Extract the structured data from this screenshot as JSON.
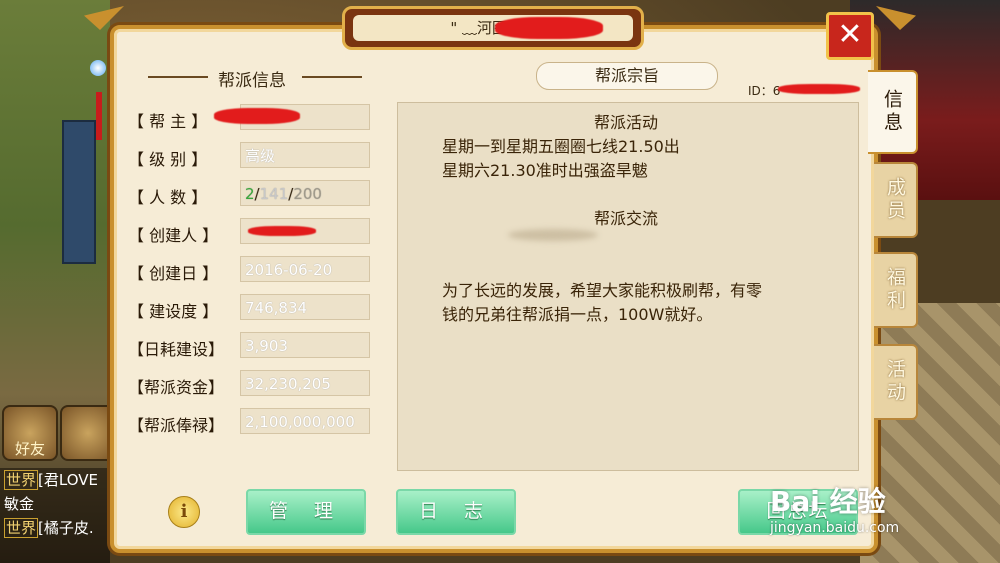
{
  "window": {
    "title": "\" ﹏河图......",
    "close_icon_glyph": "✕"
  },
  "left": {
    "section_title": "帮派信息",
    "rows": [
      {
        "label": "【  帮  主  】",
        "value": ""
      },
      {
        "label": "【  级  别  】",
        "value": "高级"
      },
      {
        "label": "【  人  数  】",
        "value": ""
      },
      {
        "label": "【  创建人  】",
        "value": ""
      },
      {
        "label": "【  创建日  】",
        "value": "2016-06-20"
      },
      {
        "label": "【  建设度  】",
        "value": "746,834"
      },
      {
        "label": "【日耗建设】",
        "value": "3,903"
      },
      {
        "label": "【帮派资金】",
        "value": "32,230,205"
      },
      {
        "label": "【帮派俸禄】",
        "value": "2,100,000,000"
      }
    ],
    "member_count": {
      "online": "2",
      "members": "141",
      "max": "200",
      "sep": "/"
    }
  },
  "right": {
    "purpose_button": "帮派宗旨",
    "id_label": "ID：6",
    "content": {
      "heading1": "帮派活动",
      "line1": "星期一到星期五圈圈七线21.50出",
      "line2": "星期六21.30准时出强盗旱魃",
      "heading2": "帮派交流",
      "para_line1": "为了长远的发展，希望大家能积极刷帮，有零",
      "para_line2": "钱的兄弟往帮派捐一点，100W就好。"
    }
  },
  "tabs": [
    {
      "label": "信息"
    },
    {
      "label": "成员"
    },
    {
      "label": "福利"
    },
    {
      "label": "活动"
    }
  ],
  "buttons": {
    "manage": "管 理",
    "log": "日 志",
    "return": "回总坛"
  },
  "chat": {
    "friend_label": "好友",
    "lines": [
      {
        "tag": "世界",
        "text": "[君LOVE"
      },
      {
        "tag": "",
        "text": "敏金"
      },
      {
        "tag": "世界",
        "text": "[橘子皮."
      }
    ]
  },
  "watermark": {
    "main": "Bai 经验",
    "sub": "jingyan.baidu.com"
  },
  "colors": {
    "accent_gold": "#c9902e",
    "panel_bg": "#f6ecd6",
    "green_button": "#46c88a",
    "close_red": "#c8261c"
  }
}
